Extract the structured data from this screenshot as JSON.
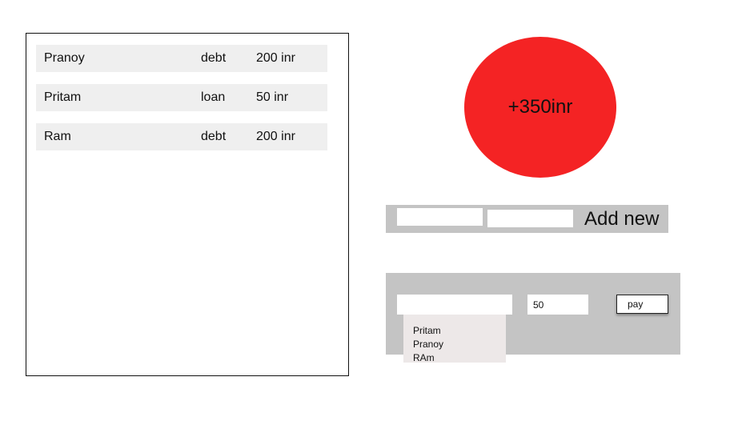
{
  "ledger": {
    "entries": [
      {
        "name": "Pranoy",
        "kind": "debt",
        "amount": "200 inr"
      },
      {
        "name": "Pritam",
        "kind": "loan",
        "amount": "50 inr"
      },
      {
        "name": "Ram",
        "kind": "debt",
        "amount": "200 inr"
      }
    ]
  },
  "balance": {
    "text": "+350inr",
    "color": "#f42324"
  },
  "add_form": {
    "field1_value": "",
    "field2_value": "",
    "button_label": "Add new"
  },
  "pay_form": {
    "person_value": "",
    "amount_value": "50",
    "button_label": "pay",
    "dropdown_options": [
      "Pritam",
      "Pranoy",
      "RAm"
    ]
  }
}
